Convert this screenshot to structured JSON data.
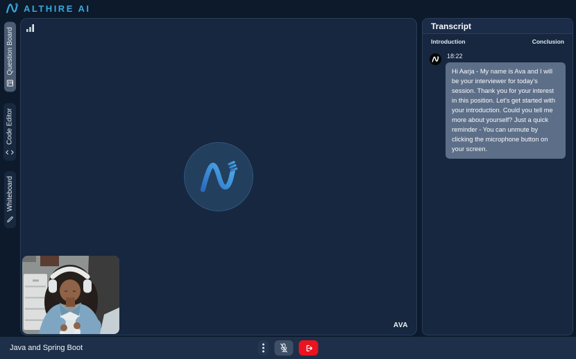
{
  "header": {
    "brand": "ALTHIRE AI"
  },
  "sidebar": {
    "items": [
      {
        "label": "Question Board",
        "icon": "question-board-icon",
        "active": true
      },
      {
        "label": "Code Editor",
        "icon": "code-editor-icon",
        "active": false
      },
      {
        "label": "Whiteboard",
        "icon": "whiteboard-icon",
        "active": false
      }
    ]
  },
  "stage": {
    "participant_label": "AVA",
    "icons": {
      "signal": "signal-bars-icon",
      "avatar_logo": "althire-monogram-icon"
    }
  },
  "transcript": {
    "title": "Transcript",
    "phase_left": "Introduction",
    "phase_right": "Conclusion",
    "messages": [
      {
        "time": "18:22",
        "text": "Hi Aarja - My name is Ava and I will be your interviewer for today's session. Thank you for your interest in this position. Let's get started with your introduction. Could you tell me more about yourself? Just a quick reminder - You can unmute by clicking the microphone button on your screen."
      }
    ]
  },
  "footer": {
    "session_title": "Java and Spring Boot",
    "icons": {
      "more": "kebab-menu-icon",
      "mic": "mic-off-icon",
      "leave": "leave-call-icon"
    }
  },
  "colors": {
    "accent_cyan": "#38a8d8",
    "danger_red": "#e8141f",
    "bubble_slate": "#5d6f88",
    "panel_navy": "#16273f",
    "active_tab": "#4b5b71",
    "brand_gradient_start": "#2a6cc0",
    "brand_gradient_end": "#4fb0ea"
  }
}
